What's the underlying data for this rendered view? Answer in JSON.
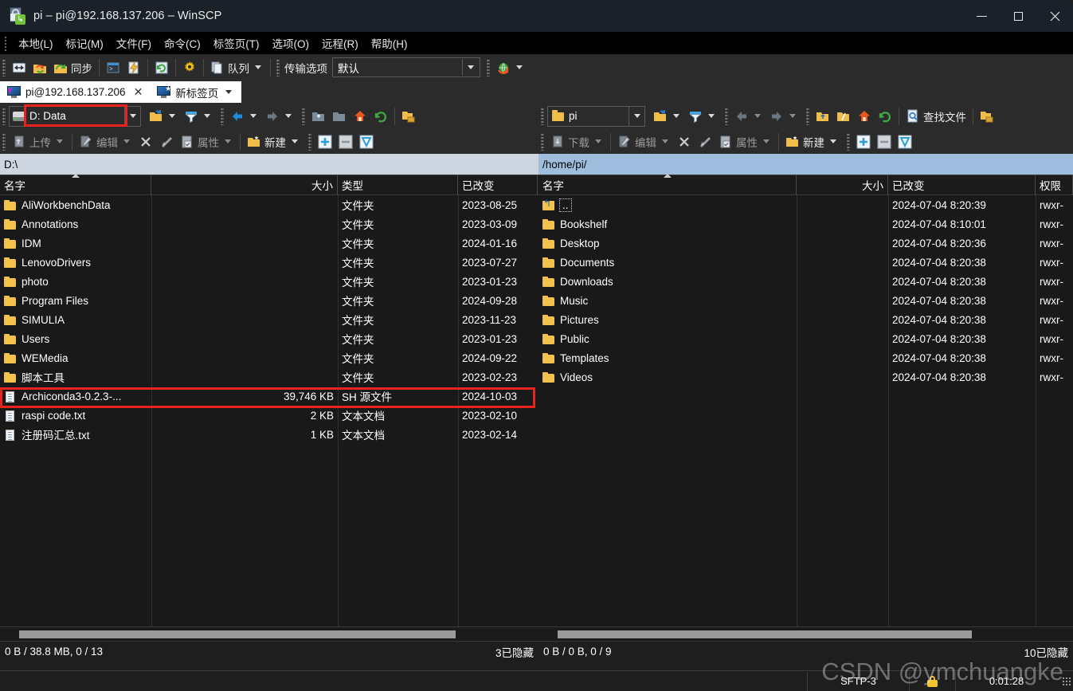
{
  "window": {
    "title": "pi – pi@192.168.137.206 – WinSCP",
    "minimize": "—",
    "maximize": "□",
    "close": "✕"
  },
  "menubar": {
    "items": [
      {
        "label": "本地(L)"
      },
      {
        "label": "标记(M)"
      },
      {
        "label": "文件(F)"
      },
      {
        "label": "命令(C)"
      },
      {
        "label": "标签页(T)"
      },
      {
        "label": "选项(O)"
      },
      {
        "label": "远程(R)"
      },
      {
        "label": "帮助(H)"
      }
    ]
  },
  "toolbar": {
    "sync_label": "同步",
    "queue_label": "队列",
    "transfer_options_label": "传输选项",
    "transfer_options_value": "默认"
  },
  "tabs": {
    "active": "pi@192.168.137.206",
    "close_glyph": "✕",
    "new_tab": "新标签页"
  },
  "left_panel": {
    "drive_value": "D: Data",
    "toolbar2": {
      "upload": "上传",
      "edit": "编辑",
      "properties": "属性",
      "new": "新建"
    },
    "path": "D:\\",
    "columns": [
      {
        "label": "名字",
        "align": "left"
      },
      {
        "label": "大小",
        "align": "right"
      },
      {
        "label": "类型",
        "align": "left"
      },
      {
        "label": "已改变",
        "align": "left"
      }
    ],
    "rows": [
      {
        "icon": "folder-icon",
        "name": "AliWorkbenchData",
        "size": "",
        "type": "文件夹",
        "changed": "2023-08-25"
      },
      {
        "icon": "folder-icon",
        "name": "Annotations",
        "size": "",
        "type": "文件夹",
        "changed": "2023-03-09"
      },
      {
        "icon": "folder-icon",
        "name": "IDM",
        "size": "",
        "type": "文件夹",
        "changed": "2024-01-16"
      },
      {
        "icon": "folder-icon",
        "name": "LenovoDrivers",
        "size": "",
        "type": "文件夹",
        "changed": "2023-07-27"
      },
      {
        "icon": "folder-icon",
        "name": "photo",
        "size": "",
        "type": "文件夹",
        "changed": "2023-01-23"
      },
      {
        "icon": "folder-icon",
        "name": "Program Files",
        "size": "",
        "type": "文件夹",
        "changed": "2024-09-28"
      },
      {
        "icon": "folder-icon",
        "name": "SIMULIA",
        "size": "",
        "type": "文件夹",
        "changed": "2023-11-23"
      },
      {
        "icon": "folder-icon",
        "name": "Users",
        "size": "",
        "type": "文件夹",
        "changed": "2023-01-23"
      },
      {
        "icon": "folder-icon",
        "name": "WEMedia",
        "size": "",
        "type": "文件夹",
        "changed": "2024-09-22"
      },
      {
        "icon": "folder-icon",
        "name": "脚本工具",
        "size": "",
        "type": "文件夹",
        "changed": "2023-02-23"
      },
      {
        "icon": "file-icon",
        "name": "Archiconda3-0.2.3-...",
        "size": "39,746 KB",
        "type": "SH 源文件",
        "changed": "2024-10-03"
      },
      {
        "icon": "file-icon",
        "name": "raspi code.txt",
        "size": "2 KB",
        "type": "文本文档",
        "changed": "2023-02-10"
      },
      {
        "icon": "file-icon",
        "name": "注册码汇总.txt",
        "size": "1 KB",
        "type": "文本文档",
        "changed": "2023-02-14"
      }
    ],
    "status_left": "0 B / 38.8 MB,  0 / 13",
    "status_right": "3已隐藏"
  },
  "right_panel": {
    "drive_value": "pi",
    "find_files": "查找文件",
    "toolbar2": {
      "download": "下载",
      "edit": "编辑",
      "properties": "属性",
      "new": "新建"
    },
    "path": "/home/pi/",
    "columns": [
      {
        "label": "名字",
        "align": "left"
      },
      {
        "label": "大小",
        "align": "right"
      },
      {
        "label": "已改变",
        "align": "left"
      },
      {
        "label": "权限",
        "align": "left"
      }
    ],
    "rows": [
      {
        "icon": "parent-dir-icon",
        "name": "..",
        "size": "",
        "changed": "2024-07-04 8:20:39",
        "perm": "rwxr-"
      },
      {
        "icon": "folder-icon",
        "name": "Bookshelf",
        "size": "",
        "changed": "2024-07-04 8:10:01",
        "perm": "rwxr-"
      },
      {
        "icon": "folder-icon",
        "name": "Desktop",
        "size": "",
        "changed": "2024-07-04 8:20:36",
        "perm": "rwxr-"
      },
      {
        "icon": "folder-icon",
        "name": "Documents",
        "size": "",
        "changed": "2024-07-04 8:20:38",
        "perm": "rwxr-"
      },
      {
        "icon": "folder-icon",
        "name": "Downloads",
        "size": "",
        "changed": "2024-07-04 8:20:38",
        "perm": "rwxr-"
      },
      {
        "icon": "folder-icon",
        "name": "Music",
        "size": "",
        "changed": "2024-07-04 8:20:38",
        "perm": "rwxr-"
      },
      {
        "icon": "folder-icon",
        "name": "Pictures",
        "size": "",
        "changed": "2024-07-04 8:20:38",
        "perm": "rwxr-"
      },
      {
        "icon": "folder-icon",
        "name": "Public",
        "size": "",
        "changed": "2024-07-04 8:20:38",
        "perm": "rwxr-"
      },
      {
        "icon": "folder-icon",
        "name": "Templates",
        "size": "",
        "changed": "2024-07-04 8:20:38",
        "perm": "rwxr-"
      },
      {
        "icon": "folder-icon",
        "name": "Videos",
        "size": "",
        "changed": "2024-07-04 8:20:38",
        "perm": "rwxr-"
      }
    ],
    "status_left": "0 B / 0 B,  0 / 9",
    "status_right": "10已隐藏"
  },
  "bottom_bar": {
    "protocol": "SFTP-3",
    "lock_icon": "lock-icon",
    "duration": "0:01:28"
  },
  "watermark": "CSDN @ymchuangke",
  "colors": {
    "accent_blue": "#9fbede",
    "annotation_red": "#e8231f",
    "folder_yellow": "#f2c14e",
    "panel_bg": "#191919",
    "toolbar_bg": "#2b2b2b"
  }
}
